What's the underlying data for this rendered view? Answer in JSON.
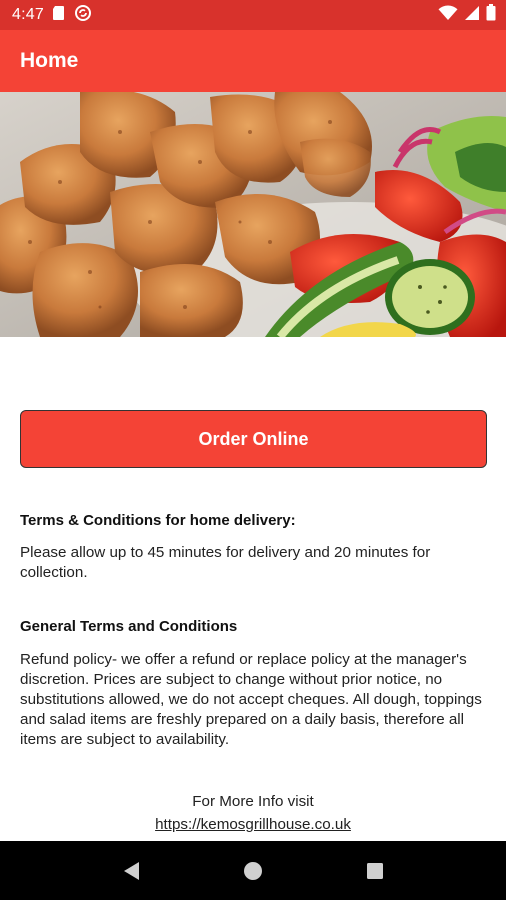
{
  "status_bar": {
    "time": "4:47",
    "icons_left": [
      "sd-card-icon",
      "sync-icon"
    ],
    "icons_right": [
      "wifi-icon",
      "signal-icon",
      "battery-icon"
    ]
  },
  "app_bar": {
    "title": "Home"
  },
  "carousel": {
    "slide_count": 3,
    "active_index": 1,
    "image": "grilled-chicken-skewer-with-salad"
  },
  "order_button": {
    "label": "Order Online"
  },
  "home_delivery": {
    "title": "Terms & Conditions for home delivery:",
    "body": "Please allow up to 45 minutes for delivery and 20 minutes for collection."
  },
  "general_terms": {
    "title": "General Terms and Conditions",
    "body": "Refund policy- we offer a refund or replace policy at the manager's discretion. Prices are subject to change without prior notice, no substitutions allowed, we do not accept cheques. All dough, toppings and salad items are freshly prepared on a daily basis, therefore all items are subject to availability."
  },
  "footer": {
    "more_info": "For More Info visit",
    "link": "https://kemosgrillhouse.co.uk"
  },
  "nav_bar": {
    "buttons": [
      "back-icon",
      "home-icon",
      "recents-icon"
    ]
  },
  "colors": {
    "status_bar": "#d8322c",
    "app_bar": "#f44336",
    "button": "#f44336",
    "nav_bar": "#000000"
  }
}
